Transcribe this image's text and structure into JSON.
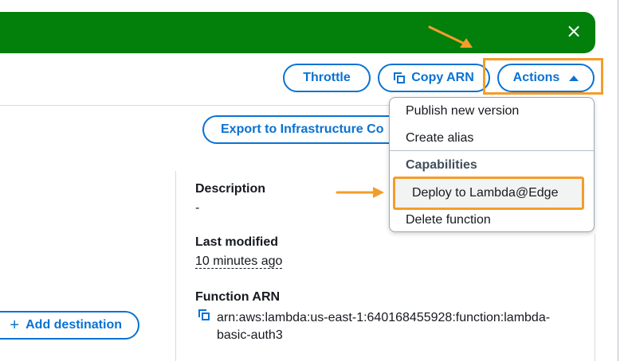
{
  "banner": {
    "close_glyph": "×"
  },
  "toolbar": {
    "throttle": "Throttle",
    "copy_arn": "Copy ARN",
    "actions": "Actions"
  },
  "export_button": "Export to Infrastructure Co",
  "add_destination": "Add destination",
  "actions_menu": {
    "items": [
      "Publish new version",
      "Create alias"
    ],
    "group_label": "Capabilities",
    "group_items": [
      "Deploy to Lambda@Edge",
      "Delete function"
    ]
  },
  "details": {
    "description_label": "Description",
    "description_value": "-",
    "last_modified_label": "Last modified",
    "last_modified_value": "10 minutes ago",
    "arn_label": "Function ARN",
    "arn_value": "arn:aws:lambda:us-east-1:640168455928:function:lambda-basic-auth3"
  },
  "colors": {
    "banner": "#037f0c",
    "link_blue": "#0972d3",
    "annotation_orange": "#f49d2a"
  },
  "icons": [
    "close-icon",
    "copy-icon",
    "caret-up-icon",
    "plus-icon",
    "arrow-annotation-icon"
  ]
}
